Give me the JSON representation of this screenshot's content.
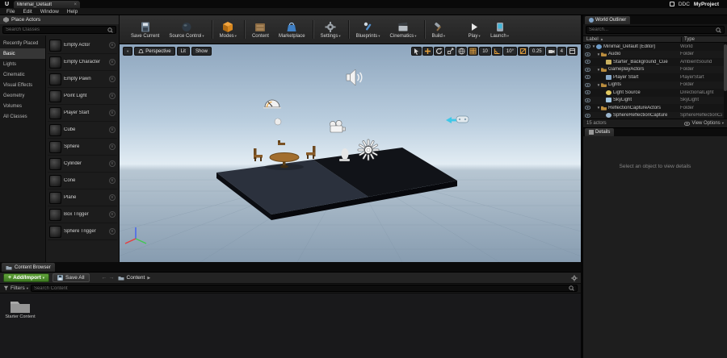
{
  "colors": {
    "accent_orange": "#e8a33d",
    "add_import_green": "#4a8f28",
    "player_start_cyan": "#3fc8e8",
    "sky_top": "#8ea6be",
    "sky_horizon": "#e2ecf3",
    "panel_dark": "#1c1c1c"
  },
  "titlebar": {
    "tab_title": "Minimal_Default",
    "menus": [
      "File",
      "Edit",
      "Window",
      "Help"
    ],
    "ddc_label": "DDC",
    "project_name": "MyProject"
  },
  "place_actors": {
    "title": "Place Actors",
    "search_placeholder": "Search Classes",
    "categories": [
      "Recently Placed",
      "Basic",
      "Lights",
      "Cinematic",
      "Visual Effects",
      "Geometry",
      "Volumes",
      "All Classes"
    ],
    "active_category": "Basic",
    "items": [
      "Empty Actor",
      "Empty Character",
      "Empty Pawn",
      "Point Light",
      "Player Start",
      "Cube",
      "Sphere",
      "Cylinder",
      "Cone",
      "Plane",
      "Box Trigger",
      "Sphere Trigger"
    ]
  },
  "main_toolbar": {
    "buttons": [
      "Save Current",
      "Source Control",
      "Modes",
      "Content",
      "Marketplace",
      "Settings",
      "Blueprints",
      "Cinematics",
      "Build",
      "Play",
      "Launch"
    ]
  },
  "viewport": {
    "perspective_label": "Perspective",
    "lit_label": "Lit",
    "show_label": "Show",
    "grid_snap_value": "10",
    "rotation_snap_value": "10°",
    "scale_snap_value": "0.25",
    "camera_speed_value": "4"
  },
  "world_outliner": {
    "title": "World Outliner",
    "search_placeholder": "Search...",
    "column_label": "Label",
    "column_type": "Type",
    "rows": [
      {
        "label": "Minimal_Default (Editor)",
        "type": "World"
      },
      {
        "label": "Audio",
        "type": "Folder"
      },
      {
        "label": "Starter_Background_Cue",
        "type": "AmbientSound"
      },
      {
        "label": "GameplayActors",
        "type": "Folder"
      },
      {
        "label": "Player Start",
        "type": "PlayerStart"
      },
      {
        "label": "Lights",
        "type": "Folder"
      },
      {
        "label": "Light Source",
        "type": "DirectionalLight"
      },
      {
        "label": "SkyLight",
        "type": "SkyLight"
      },
      {
        "label": "ReflectionCaptureActors",
        "type": "Folder"
      },
      {
        "label": "SphereReflectionCapture",
        "type": "SphereReflectionCapture"
      }
    ],
    "footer_count": "15 actors",
    "view_options_label": "View Options"
  },
  "details": {
    "title": "Details",
    "empty_message": "Select an object to view details"
  },
  "content_browser": {
    "tab_title": "Content Browser",
    "add_import_label": "Add/Import",
    "save_all_label": "Save All",
    "breadcrumb_root": "Content",
    "filters_label": "Filters",
    "search_placeholder": "Search Content",
    "assets": [
      {
        "name": "Starter Content",
        "kind": "folder"
      }
    ]
  }
}
